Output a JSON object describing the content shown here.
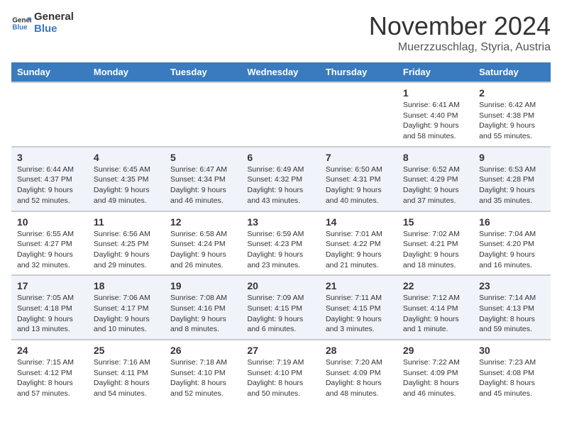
{
  "logo": {
    "line1": "General",
    "line2": "Blue"
  },
  "title": "November 2024",
  "location": "Muerzzuschlag, Styria, Austria",
  "days_of_week": [
    "Sunday",
    "Monday",
    "Tuesday",
    "Wednesday",
    "Thursday",
    "Friday",
    "Saturday"
  ],
  "weeks": [
    {
      "days": [
        {
          "num": "",
          "info": ""
        },
        {
          "num": "",
          "info": ""
        },
        {
          "num": "",
          "info": ""
        },
        {
          "num": "",
          "info": ""
        },
        {
          "num": "",
          "info": ""
        },
        {
          "num": "1",
          "info": "Sunrise: 6:41 AM\nSunset: 4:40 PM\nDaylight: 9 hours and 58 minutes."
        },
        {
          "num": "2",
          "info": "Sunrise: 6:42 AM\nSunset: 4:38 PM\nDaylight: 9 hours and 55 minutes."
        }
      ]
    },
    {
      "days": [
        {
          "num": "3",
          "info": "Sunrise: 6:44 AM\nSunset: 4:37 PM\nDaylight: 9 hours and 52 minutes."
        },
        {
          "num": "4",
          "info": "Sunrise: 6:45 AM\nSunset: 4:35 PM\nDaylight: 9 hours and 49 minutes."
        },
        {
          "num": "5",
          "info": "Sunrise: 6:47 AM\nSunset: 4:34 PM\nDaylight: 9 hours and 46 minutes."
        },
        {
          "num": "6",
          "info": "Sunrise: 6:49 AM\nSunset: 4:32 PM\nDaylight: 9 hours and 43 minutes."
        },
        {
          "num": "7",
          "info": "Sunrise: 6:50 AM\nSunset: 4:31 PM\nDaylight: 9 hours and 40 minutes."
        },
        {
          "num": "8",
          "info": "Sunrise: 6:52 AM\nSunset: 4:29 PM\nDaylight: 9 hours and 37 minutes."
        },
        {
          "num": "9",
          "info": "Sunrise: 6:53 AM\nSunset: 4:28 PM\nDaylight: 9 hours and 35 minutes."
        }
      ]
    },
    {
      "days": [
        {
          "num": "10",
          "info": "Sunrise: 6:55 AM\nSunset: 4:27 PM\nDaylight: 9 hours and 32 minutes."
        },
        {
          "num": "11",
          "info": "Sunrise: 6:56 AM\nSunset: 4:25 PM\nDaylight: 9 hours and 29 minutes."
        },
        {
          "num": "12",
          "info": "Sunrise: 6:58 AM\nSunset: 4:24 PM\nDaylight: 9 hours and 26 minutes."
        },
        {
          "num": "13",
          "info": "Sunrise: 6:59 AM\nSunset: 4:23 PM\nDaylight: 9 hours and 23 minutes."
        },
        {
          "num": "14",
          "info": "Sunrise: 7:01 AM\nSunset: 4:22 PM\nDaylight: 9 hours and 21 minutes."
        },
        {
          "num": "15",
          "info": "Sunrise: 7:02 AM\nSunset: 4:21 PM\nDaylight: 9 hours and 18 minutes."
        },
        {
          "num": "16",
          "info": "Sunrise: 7:04 AM\nSunset: 4:20 PM\nDaylight: 9 hours and 16 minutes."
        }
      ]
    },
    {
      "days": [
        {
          "num": "17",
          "info": "Sunrise: 7:05 AM\nSunset: 4:18 PM\nDaylight: 9 hours and 13 minutes."
        },
        {
          "num": "18",
          "info": "Sunrise: 7:06 AM\nSunset: 4:17 PM\nDaylight: 9 hours and 10 minutes."
        },
        {
          "num": "19",
          "info": "Sunrise: 7:08 AM\nSunset: 4:16 PM\nDaylight: 9 hours and 8 minutes."
        },
        {
          "num": "20",
          "info": "Sunrise: 7:09 AM\nSunset: 4:15 PM\nDaylight: 9 hours and 6 minutes."
        },
        {
          "num": "21",
          "info": "Sunrise: 7:11 AM\nSunset: 4:15 PM\nDaylight: 9 hours and 3 minutes."
        },
        {
          "num": "22",
          "info": "Sunrise: 7:12 AM\nSunset: 4:14 PM\nDaylight: 9 hours and 1 minute."
        },
        {
          "num": "23",
          "info": "Sunrise: 7:14 AM\nSunset: 4:13 PM\nDaylight: 8 hours and 59 minutes."
        }
      ]
    },
    {
      "days": [
        {
          "num": "24",
          "info": "Sunrise: 7:15 AM\nSunset: 4:12 PM\nDaylight: 8 hours and 57 minutes."
        },
        {
          "num": "25",
          "info": "Sunrise: 7:16 AM\nSunset: 4:11 PM\nDaylight: 8 hours and 54 minutes."
        },
        {
          "num": "26",
          "info": "Sunrise: 7:18 AM\nSunset: 4:10 PM\nDaylight: 8 hours and 52 minutes."
        },
        {
          "num": "27",
          "info": "Sunrise: 7:19 AM\nSunset: 4:10 PM\nDaylight: 8 hours and 50 minutes."
        },
        {
          "num": "28",
          "info": "Sunrise: 7:20 AM\nSunset: 4:09 PM\nDaylight: 8 hours and 48 minutes."
        },
        {
          "num": "29",
          "info": "Sunrise: 7:22 AM\nSunset: 4:09 PM\nDaylight: 8 hours and 46 minutes."
        },
        {
          "num": "30",
          "info": "Sunrise: 7:23 AM\nSunset: 4:08 PM\nDaylight: 8 hours and 45 minutes."
        }
      ]
    }
  ]
}
